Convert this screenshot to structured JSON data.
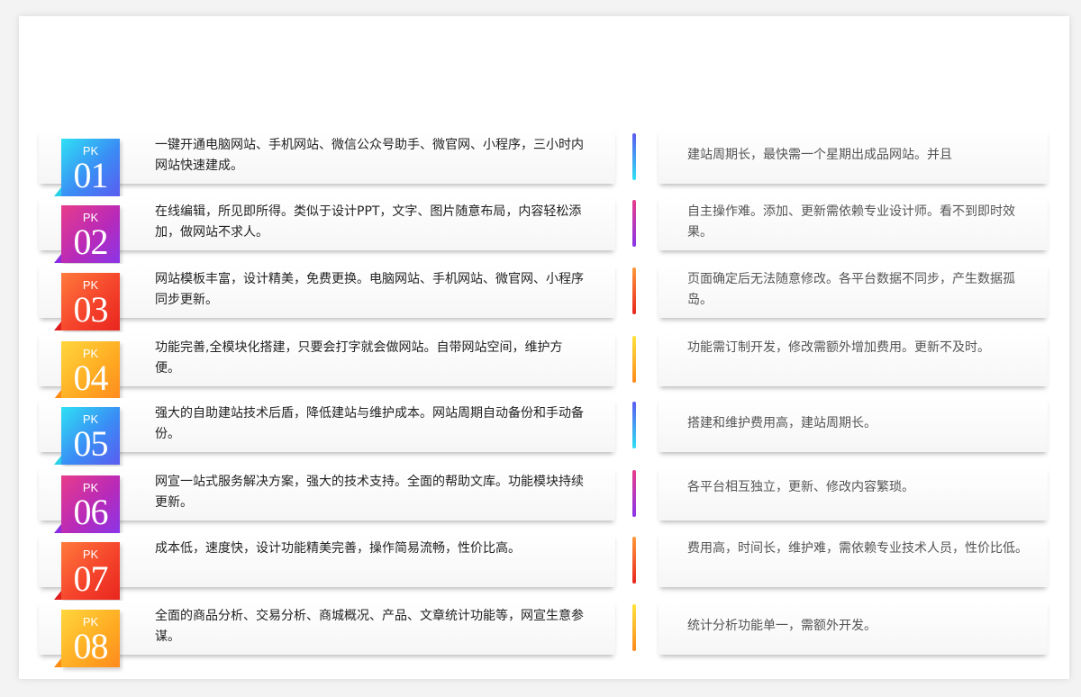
{
  "rows": [
    {
      "pk": "PK",
      "num": "01",
      "color": "blue",
      "left": "一键开通电脑网站、手机网站、微信公众号助手、微官网、小程序，三小时内网站快速建成。",
      "right": "建站周期长，最快需一个星期出成品网站。并且"
    },
    {
      "pk": "PK",
      "num": "02",
      "color": "purple",
      "left": "在线编辑，所见即所得。类似于设计PPT，文字、图片随意布局，内容轻松添加，做网站不求人。",
      "right": "自主操作难。添加、更新需依赖专业设计师。看不到即时效果。"
    },
    {
      "pk": "PK",
      "num": "03",
      "color": "red",
      "left": "网站模板丰富，设计精美，免费更换。电脑网站、手机网站、微官网、小程序同步更新。",
      "right": "页面确定后无法随意修改。各平台数据不同步，产生数据孤岛。"
    },
    {
      "pk": "PK",
      "num": "04",
      "color": "yellow",
      "left": "功能完善,全模块化搭建，只要会打字就会做网站。自带网站空间，维护方便。",
      "right": "功能需订制开发，修改需额外增加费用。更新不及时。"
    },
    {
      "pk": "PK",
      "num": "05",
      "color": "blue",
      "left": "强大的自助建站技术后盾，降低建站与维护成本。网站周期自动备份和手动备份。",
      "right": "搭建和维护费用高，建站周期长。"
    },
    {
      "pk": "PK",
      "num": "06",
      "color": "purple",
      "left": "网宣一站式服务解决方案，强大的技术支持。全面的帮助文库。功能模块持续更新。",
      "right": "各平台相互独立，更新、修改内容繁琐。"
    },
    {
      "pk": "PK",
      "num": "07",
      "color": "red",
      "left": "成本低，速度快，设计功能精美完善，操作简易流畅，性价比高。",
      "right": "费用高，时间长，维护难，需依赖专业技术人员，性价比低。"
    },
    {
      "pk": "PK",
      "num": "08",
      "color": "yellow",
      "left": "全面的商品分析、交易分析、商城概况、产品、文章统计功能等，网宣生意参谋。",
      "right": "统计分析功能单一，需额外开发。"
    }
  ]
}
